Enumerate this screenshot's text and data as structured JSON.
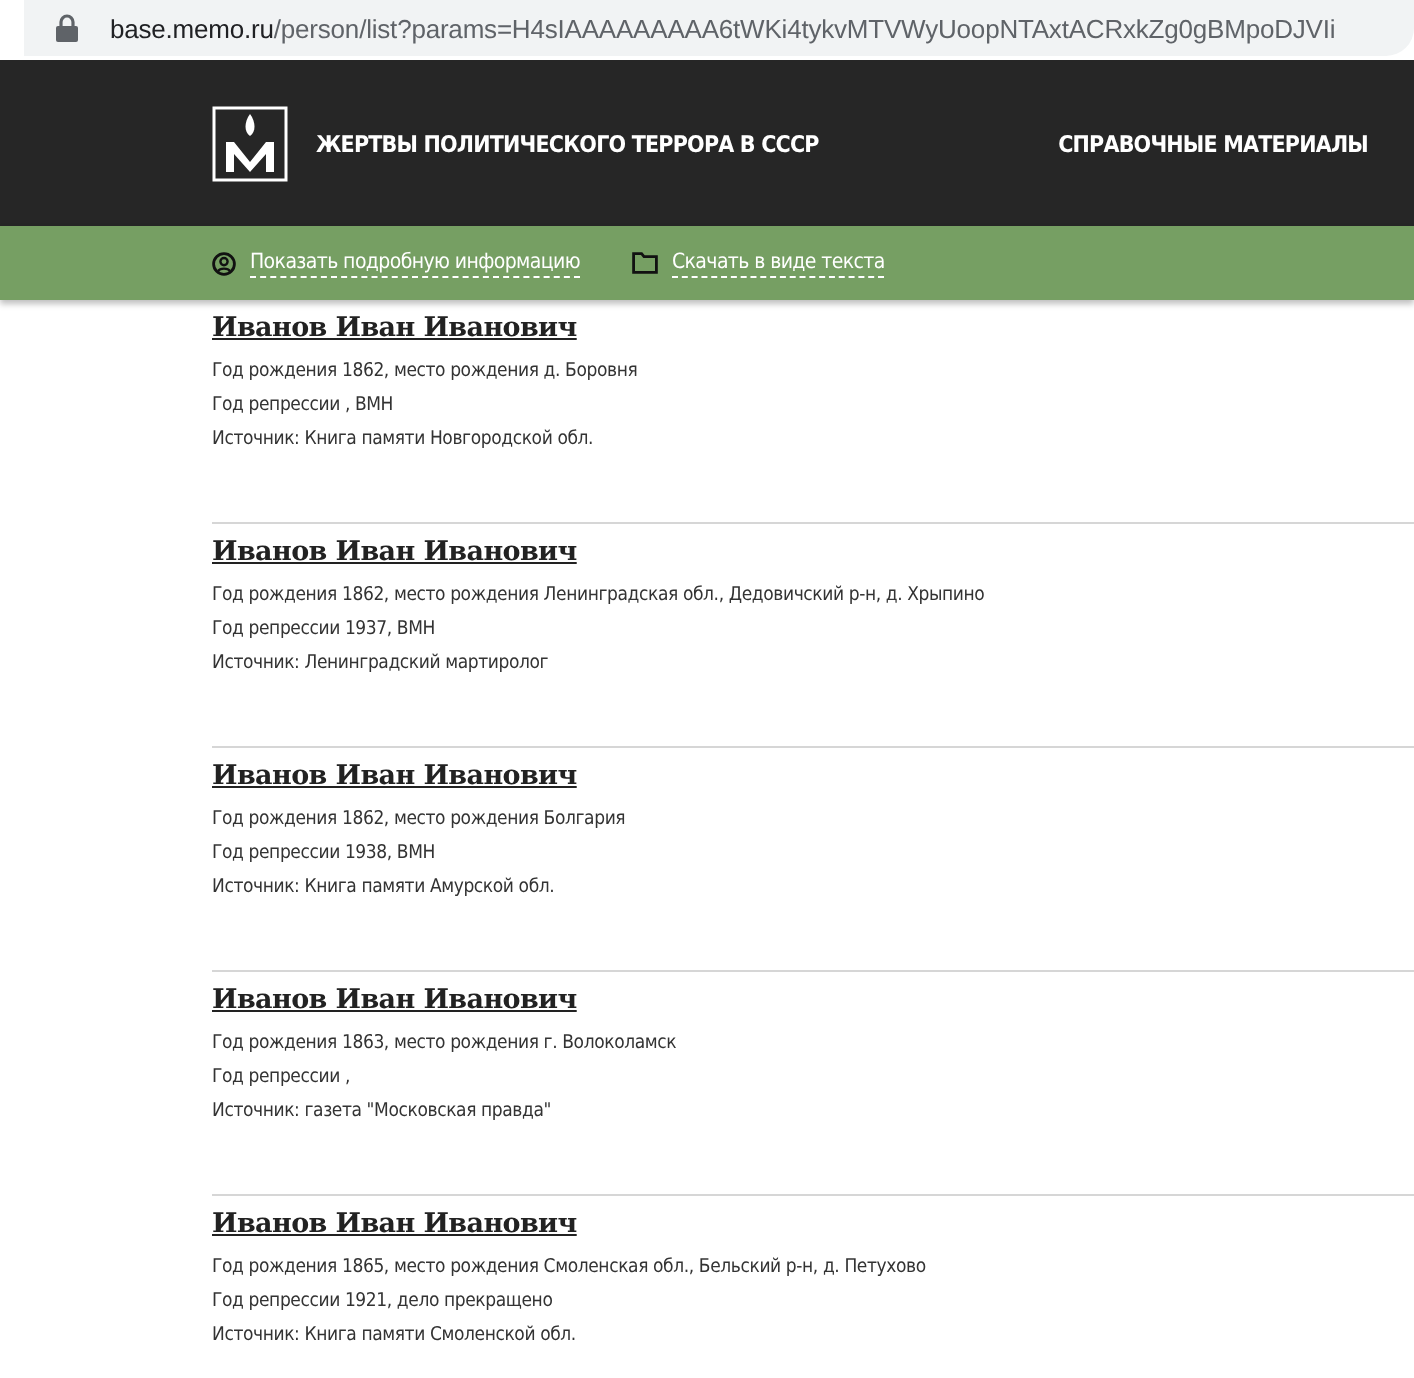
{
  "address_bar": {
    "host": "base.memo.ru",
    "path": "/person/list?params=H4sIAAAAAAAAA6tWKi4tykvMTVWyUoopNTAxtACRxkZg0gBMpoDJVIi"
  },
  "header": {
    "site_title": "ЖЕРТВЫ ПОЛИТИЧЕСКОГО ТЕРРОРА В СССР",
    "nav_link": "СПРАВОЧНЫЕ МАТЕРИАЛЫ"
  },
  "toolbar": {
    "links": [
      {
        "kind": "details",
        "label": "Показать подробную информацию"
      },
      {
        "kind": "download",
        "label": "Скачать в виде текста"
      }
    ]
  },
  "records": [
    {
      "name": "Иванов Иван Иванович",
      "lines": [
        "Год рождения 1862, место рождения д. Боровня",
        "Год репрессии , ВМН",
        "Источник: Книга памяти Новгородской обл."
      ]
    },
    {
      "name": "Иванов Иван Иванович",
      "lines": [
        "Год рождения 1862, место рождения Ленинградская обл., Дедовичский р-н, д. Хрыпино",
        "Год репрессии 1937, ВМН",
        "Источник: Ленинградский мартиролог"
      ]
    },
    {
      "name": "Иванов Иван Иванович",
      "lines": [
        "Год рождения 1862, место рождения Болгария",
        "Год репрессии 1938, ВМН",
        "Источник: Книга памяти Амурской обл."
      ]
    },
    {
      "name": "Иванов Иван Иванович",
      "lines": [
        "Год рождения 1863, место рождения г. Волоколамск",
        "Год репрессии ,",
        "Источник: газета \"Московская правда\""
      ]
    },
    {
      "name": "Иванов Иван Иванович",
      "lines": [
        "Год рождения 1865, место рождения Смоленская обл., Бельский р-н, д. Петухово",
        "Год репрессии 1921, дело прекращено",
        "Источник: Книга памяти Смоленской обл."
      ]
    }
  ]
}
